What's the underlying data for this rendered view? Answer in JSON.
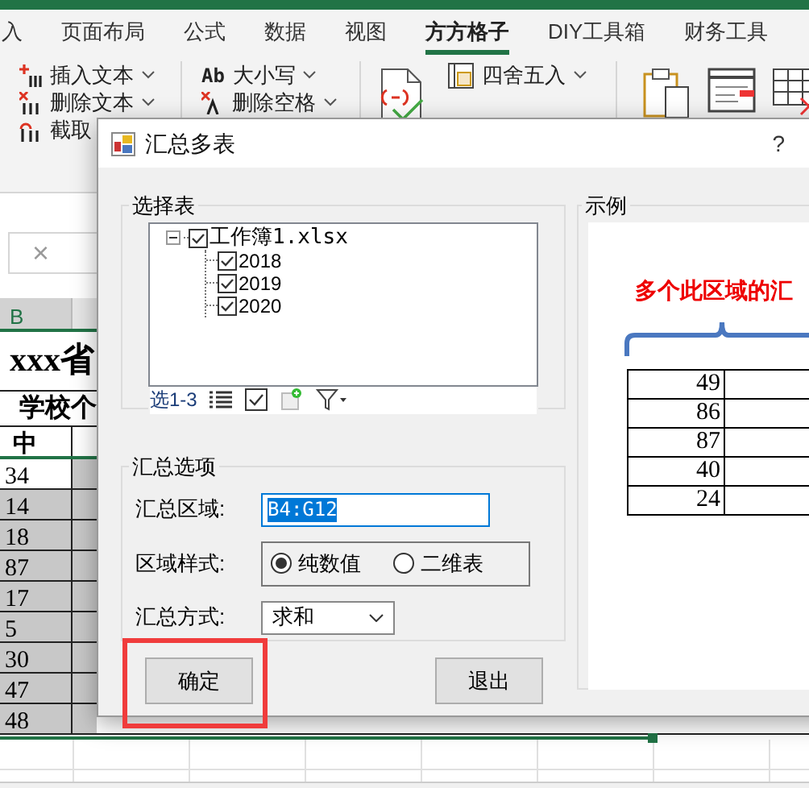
{
  "ribbon_tabs": [
    {
      "label": "入",
      "selected": false
    },
    {
      "label": "页面布局",
      "selected": false
    },
    {
      "label": "公式",
      "selected": false
    },
    {
      "label": "数据",
      "selected": false
    },
    {
      "label": "视图",
      "selected": false
    },
    {
      "label": "方方格子",
      "selected": true
    },
    {
      "label": "DIY工具箱",
      "selected": false
    },
    {
      "label": "财务工具",
      "selected": false
    }
  ],
  "ribbon_items": [
    {
      "label": "插入文本"
    },
    {
      "label": "删除文本"
    },
    {
      "label": "截取"
    },
    {
      "label": "大小写",
      "icon_text": "Ab"
    },
    {
      "label": "删除空格"
    },
    {
      "label": "四舍五入"
    }
  ],
  "formula_bar": {
    "cancel": "×"
  },
  "sheet": {
    "column_header": "B",
    "title": "xxx省",
    "subheader": "学校个",
    "column_label": "中",
    "cells": [
      {
        "value": "34",
        "selected": false
      },
      {
        "value": "14",
        "selected": true
      },
      {
        "value": "18",
        "selected": true
      },
      {
        "value": "87",
        "selected": true
      },
      {
        "value": "17",
        "selected": true
      },
      {
        "value": "5",
        "selected": true
      },
      {
        "value": "30",
        "selected": true
      },
      {
        "value": "47",
        "selected": true
      },
      {
        "value": "48",
        "selected": true
      }
    ]
  },
  "dialog": {
    "title": "汇总多表",
    "help": "?",
    "select_group": {
      "title": "选择表",
      "tree": {
        "label": "工作簿1.xlsx",
        "checked": true,
        "expanded": true,
        "children": [
          {
            "label": "2018",
            "checked": true
          },
          {
            "label": "2019",
            "checked": true
          },
          {
            "label": "2020",
            "checked": true
          }
        ]
      },
      "range_label": "选1-3"
    },
    "options_group": {
      "title": "汇总选项",
      "fields": [
        {
          "kind": "text",
          "label": "汇总区域:",
          "value": "B4:G12"
        },
        {
          "kind": "radio",
          "label": "区域样式:",
          "options": [
            {
              "label": "纯数值",
              "selected": true
            },
            {
              "label": "二维表",
              "selected": false
            }
          ]
        },
        {
          "kind": "select",
          "label": "汇总方式:",
          "value": "求和"
        }
      ]
    },
    "buttons": [
      {
        "label": "确定",
        "highlighted": true
      },
      {
        "label": "退出",
        "highlighted": false
      }
    ],
    "example": {
      "title": "示例",
      "caption": "多个此区域的汇",
      "rows": [
        "49",
        "86",
        "87",
        "40",
        "24"
      ]
    }
  }
}
